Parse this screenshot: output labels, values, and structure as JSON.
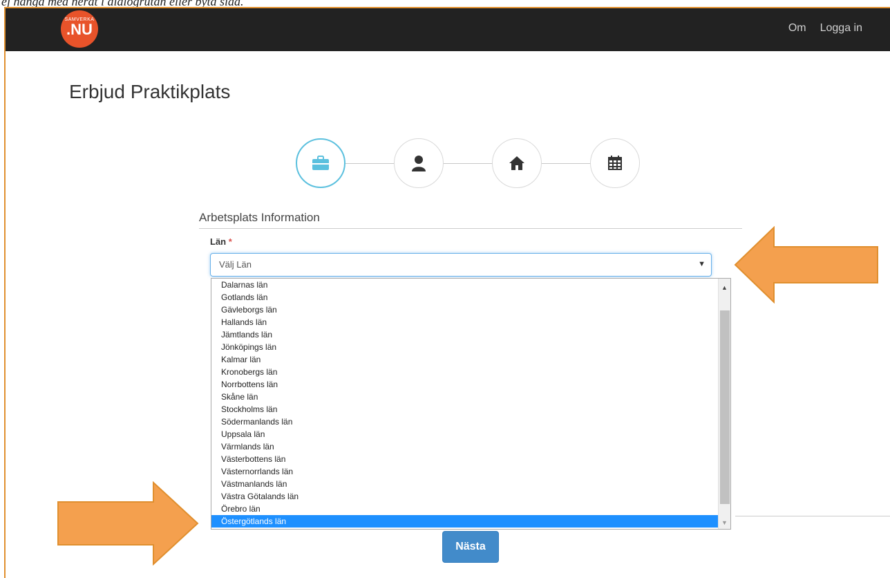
{
  "caption": "ej hänga med neråt i dialogrutan eller byta sida.",
  "header": {
    "logo_small": "SAMVERKA",
    "logo_big": ".NU",
    "nav": [
      "Om",
      "Logga in"
    ]
  },
  "page": {
    "title": "Erbjud Praktikplats",
    "steps": [
      "briefcase-icon",
      "user-icon",
      "home-icon",
      "calendar-icon"
    ],
    "active_step": 1
  },
  "form": {
    "section_title": "Arbetsplats Information",
    "field_label": "Län",
    "required_mark": "*",
    "select_value": "Välj Län",
    "options": [
      "Dalarnas län",
      "Gotlands län",
      "Gävleborgs län",
      "Hallands län",
      "Jämtlands län",
      "Jönköpings län",
      "Kalmar län",
      "Kronobergs län",
      "Norrbottens län",
      "Skåne län",
      "Stockholms län",
      "Södermanlands län",
      "Uppsala län",
      "Värmlands län",
      "Västerbottens län",
      "Västernorrlands län",
      "Västmanlands län",
      "Västra Götalands län",
      "Örebro län",
      "Östergötlands län"
    ],
    "selected_option": "Östergötlands län",
    "next_button": "Nästa"
  },
  "colors": {
    "annotation_arrow": "#f4a04e",
    "annotation_border": "#e08f2e",
    "accent": "#428bca",
    "active_step": "#5bc0de",
    "logo": "#e8532a"
  }
}
